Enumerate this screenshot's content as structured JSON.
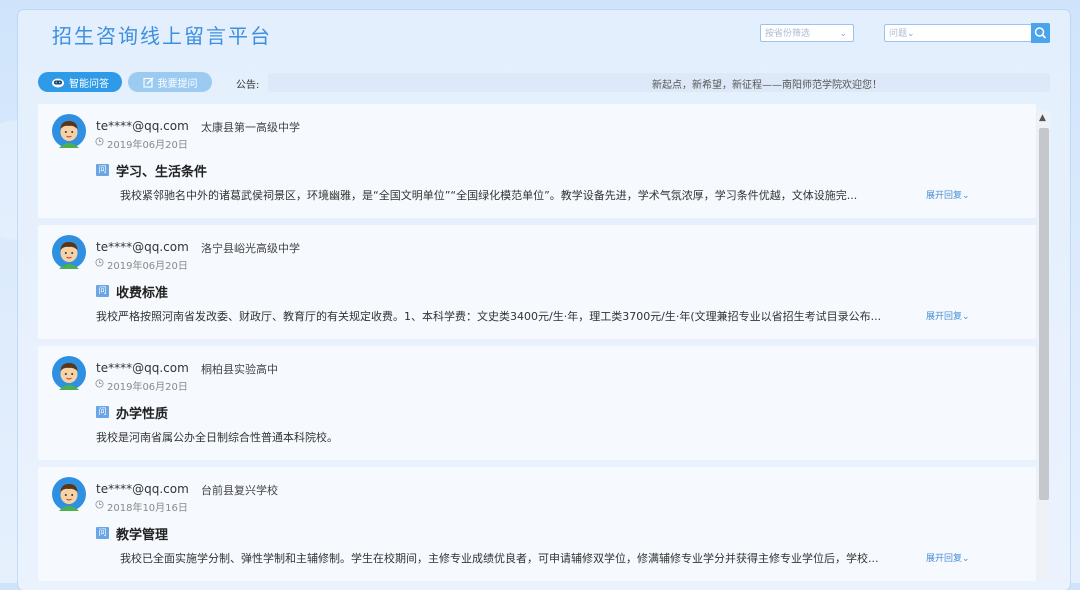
{
  "header": {
    "title": "招生咨询线上留言平台",
    "province_select": {
      "placeholder": "按省份筛选"
    },
    "search": {
      "placeholder": "问题"
    }
  },
  "toolbar": {
    "smart_qa_label": "智能问答",
    "ask_label": "我要提问",
    "notice_label": "公告:",
    "notice_text": "新起点，新希望，新征程——南阳师范学院欢迎您！"
  },
  "questions": [
    {
      "user": "te****@qq.com",
      "school": "太康县第一高级中学",
      "date": "2019年06月20日",
      "tag": "问",
      "title": "学习、生活条件",
      "answer": "我校紧邻驰名中外的诸葛武侯祠景区，环境幽雅，是“全国文明单位”“全国绿化模范单位”。教学设备先进，学术气氛浓厚，学习条件优越，文体设施完...",
      "expand": "展开回复"
    },
    {
      "user": "te****@qq.com",
      "school": "洛宁县峪光高级中学",
      "date": "2019年06月20日",
      "tag": "问",
      "title": "收费标准",
      "answer": "我校严格按照河南省发改委、财政厅、教育厅的有关规定收费。1、本科学费：文史类3400元/生·年，理工类3700元/生·年(文理兼招专业以省招生考试目录公布...",
      "expand": "展开回复"
    },
    {
      "user": "te****@qq.com",
      "school": "桐柏县实验高中",
      "date": "2019年06月20日",
      "tag": "问",
      "title": "办学性质",
      "answer": "我校是河南省属公办全日制综合性普通本科院校。",
      "expand": ""
    },
    {
      "user": "te****@qq.com",
      "school": "台前县复兴学校",
      "date": "2018年10月16日",
      "tag": "问",
      "title": "教学管理",
      "answer": "我校已全面实施学分制、弹性学制和主辅修制。学生在校期间，主修专业成绩优良者，可申请辅修双学位，修满辅修专业学分并获得主修专业学位后，学校...",
      "expand": "展开回复"
    }
  ]
}
